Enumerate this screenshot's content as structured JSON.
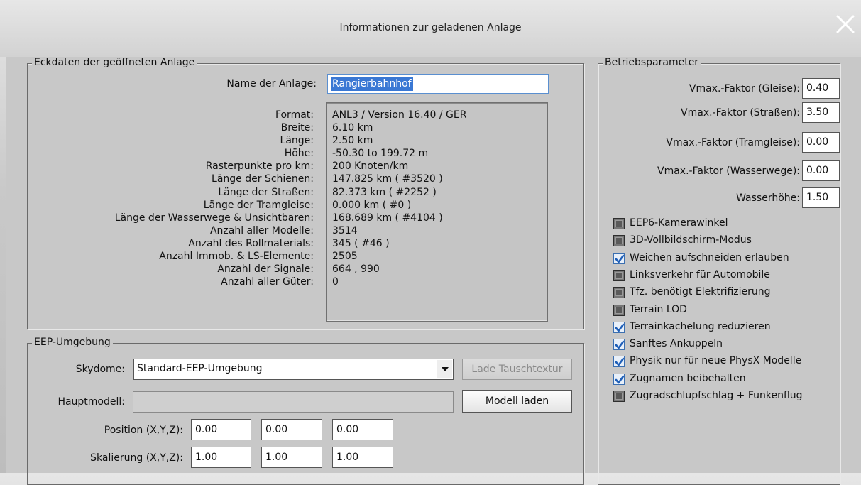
{
  "window": {
    "title": "Informationen zur geladenen Anlage"
  },
  "eckdaten": {
    "legend": "Eckdaten der geöffneten Anlage",
    "name_label": "Name der Anlage:",
    "name_value": "Rangierbahnhof",
    "rows": [
      {
        "label": "Format:",
        "value": "ANL3 / Version 16.40 / GER"
      },
      {
        "label": "Breite:",
        "value": "6.10 km"
      },
      {
        "label": "Länge:",
        "value": "2.50 km"
      },
      {
        "label": "Höhe:",
        "value": "-50.30 to 199.72 m"
      },
      {
        "label": "Rasterpunkte pro km:",
        "value": "200 Knoten/km"
      },
      {
        "label": "Länge der Schienen:",
        "value": "147.825 km ( #3520 )"
      },
      {
        "label": "Länge der Straßen:",
        "value": "82.373 km ( #2252 )"
      },
      {
        "label": "Länge der Tramgleise:",
        "value": "0.000 km ( #0 )"
      },
      {
        "label": "Länge der Wasserwege & Unsichtbaren:",
        "value": "168.689 km ( #4104 )"
      },
      {
        "label": "Anzahl aller Modelle:",
        "value": "3514"
      },
      {
        "label": "Anzahl des Rollmaterials:",
        "value": "345 ( #46 )"
      },
      {
        "label": "Anzahl Immob. & LS-Elemente:",
        "value": "2505"
      },
      {
        "label": "Anzahl der Signale:",
        "value": "664 , 990"
      },
      {
        "label": "Anzahl aller Güter:",
        "value": "0"
      }
    ]
  },
  "umgebung": {
    "legend": "EEP-Umgebung",
    "skydome_label": "Skydome:",
    "skydome_value": "Standard-EEP-Umgebung",
    "lade_button": "Lade Tauschtextur",
    "hauptmodell_label": "Hauptmodell:",
    "hauptmodell_value": "",
    "modell_button": "Modell laden",
    "position_label": "Position (X,Y,Z):",
    "position": [
      "0.00",
      "0.00",
      "0.00"
    ],
    "skalierung_label": "Skalierung (X,Y,Z):",
    "skalierung": [
      "1.00",
      "1.00",
      "1.00"
    ]
  },
  "betrieb": {
    "legend": "Betriebsparameter",
    "params": [
      {
        "label": "Vmax.-Faktor (Gleise):",
        "value": "0.40"
      },
      {
        "label": "Vmax.-Faktor (Straßen):",
        "value": "3.50"
      },
      {
        "label": "Vmax.-Faktor (Tramgleise):",
        "value": "0.00"
      },
      {
        "label": "Vmax.-Faktor (Wasserwege):",
        "value": "0.00"
      },
      {
        "label": "Wasserhöhe:",
        "value": "1.50"
      }
    ],
    "checkboxes": [
      {
        "label": "EEP6-Kamerawinkel",
        "checked": false
      },
      {
        "label": "3D-Vollbildschirm-Modus",
        "checked": false
      },
      {
        "label": "Weichen aufschneiden erlauben",
        "checked": true
      },
      {
        "label": "Linksverkehr für Automobile",
        "checked": false
      },
      {
        "label": "Tfz. benötigt Elektrifizierung",
        "checked": false
      },
      {
        "label": "Terrain LOD",
        "checked": false
      },
      {
        "label": "Terrainkachelung reduzieren",
        "checked": true
      },
      {
        "label": "Sanftes Ankuppeln",
        "checked": true
      },
      {
        "label": "Physik nur für neue PhysX Modelle",
        "checked": true
      },
      {
        "label": "Zugnamen beibehalten",
        "checked": true
      },
      {
        "label": "Zugradschlupfschlag + Funkenflug",
        "checked": false
      }
    ]
  }
}
